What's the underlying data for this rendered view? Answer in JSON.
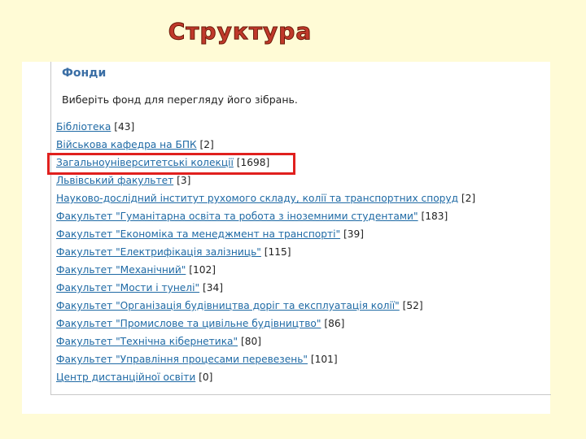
{
  "slide": {
    "title": "Структура"
  },
  "panel": {
    "heading": "Фонди",
    "prompt": "Виберіть фонд для перегляду його зібрань.",
    "funds": [
      {
        "name": "Бібліотека",
        "count": "[43]"
      },
      {
        "name": "Військова кафедра на БПК",
        "count": "[2]"
      },
      {
        "name": "Загальноуніверситетські колекції",
        "count": "[1698]"
      },
      {
        "name": "Львівський факультет",
        "count": "[3]"
      },
      {
        "name": "Науково-дослідний інститут рухомого складу, колії та транспортних споруд",
        "count": "[2]"
      },
      {
        "name": "Факультет \"Гуманітарна освіта та робота з іноземними студентами\"",
        "count": "[183]"
      },
      {
        "name": "Факультет \"Економіка та менеджмент на транспорті\"",
        "count": "[39]"
      },
      {
        "name": "Факультет \"Електрифікація залізниць\"",
        "count": "[115]"
      },
      {
        "name": "Факультет \"Механічний\"",
        "count": "[102]"
      },
      {
        "name": "Факультет \"Мости і тунелі\"",
        "count": "[34]"
      },
      {
        "name": "Факультет \"Організація будівництва доріг та експлуатація колії\"",
        "count": "[52]"
      },
      {
        "name": "Факультет \"Промислове та цивільне будівництво\"",
        "count": "[86]"
      },
      {
        "name": "Факультет \"Технічна кібернетика\"",
        "count": "[80]"
      },
      {
        "name": "Факультет \"Управління процесами перевезень\"",
        "count": "[101]"
      },
      {
        "name": "Центр дистанційної освіти",
        "count": "[0]"
      }
    ],
    "highlighted_fund": "Загальноуніверситетські колекції"
  },
  "colors": {
    "title": "#c0392b",
    "link": "#1f6aa5",
    "heading": "#3a6ea5",
    "highlight": "#e0201e",
    "background": "#fffbd6"
  }
}
